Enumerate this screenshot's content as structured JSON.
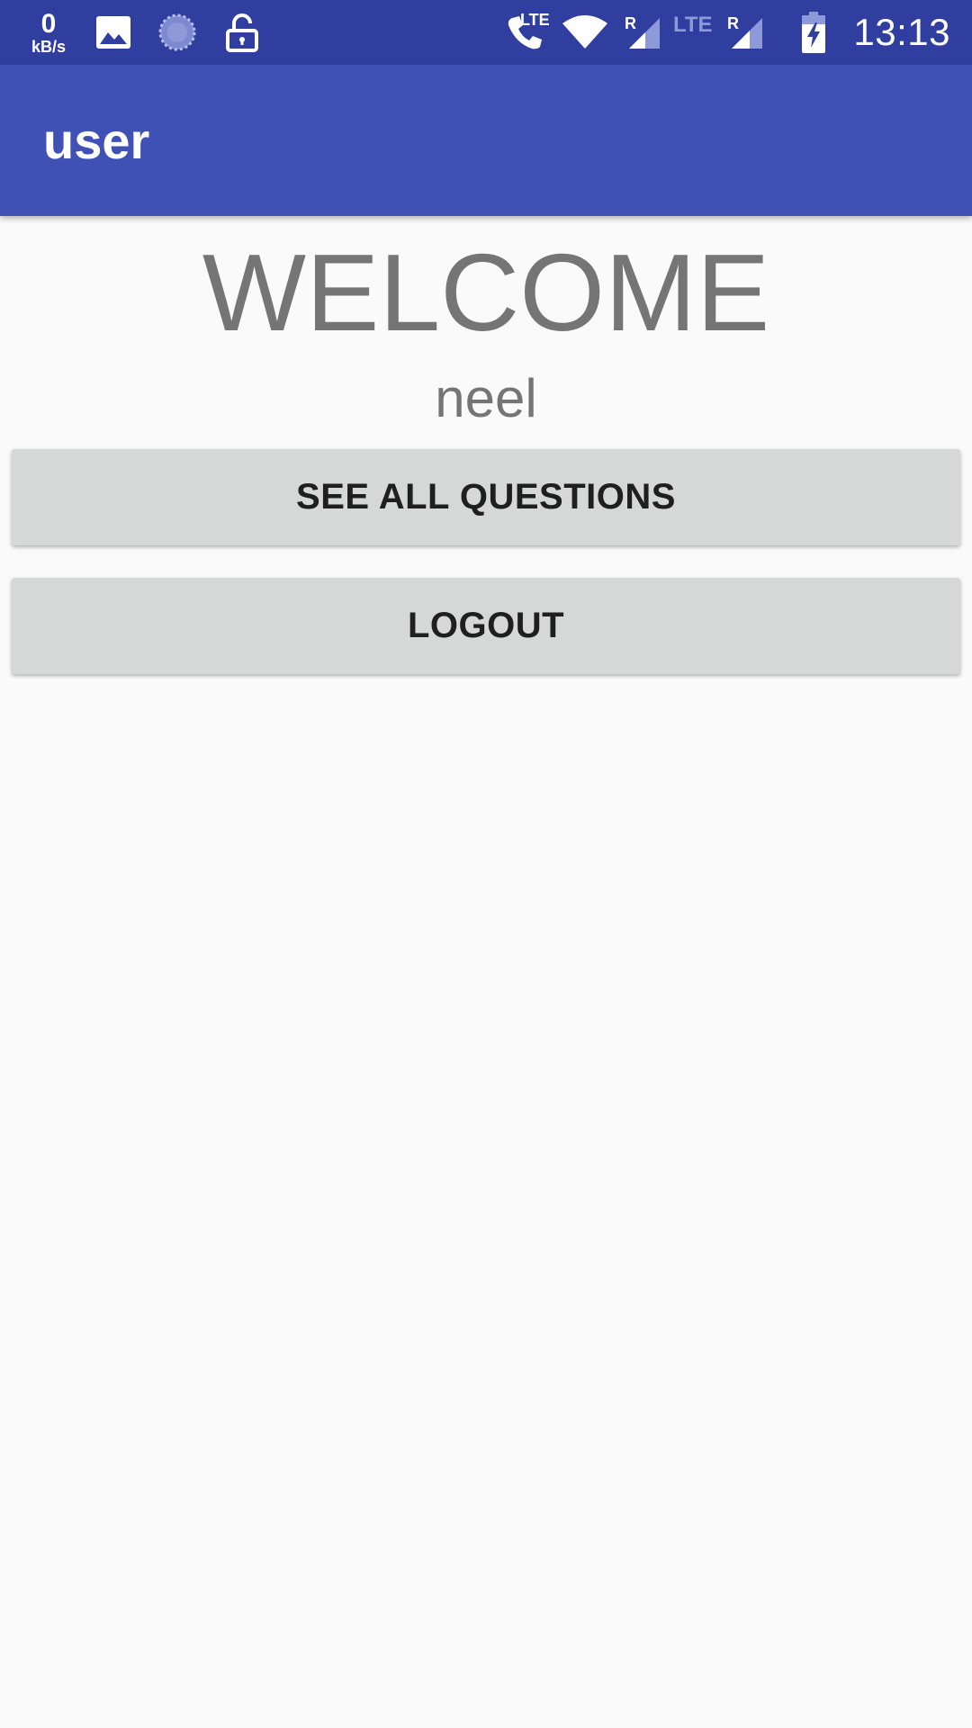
{
  "status_bar": {
    "net_speed_value": "0",
    "net_speed_unit": "kB/s",
    "call_lte_label": "LTE",
    "sim1_roaming_label": "R",
    "sim2_network_label": "LTE",
    "sim2_roaming_label": "R",
    "time": "13:13",
    "icons": [
      "image-icon",
      "sync-icon",
      "unlock-icon",
      "call-lte-icon",
      "wifi-icon",
      "signal-icon",
      "battery-charging-icon"
    ]
  },
  "app_bar": {
    "title": "user"
  },
  "main": {
    "welcome_text": "WELCOME",
    "username": "neel",
    "see_all_questions_label": "SEE ALL QUESTIONS",
    "logout_label": "LOGOUT"
  },
  "colors": {
    "status_bar": "#303f9f",
    "app_bar": "#3f51b5",
    "background": "#fafafa",
    "button": "#d6d7d7",
    "secondary_text": "#757575"
  }
}
